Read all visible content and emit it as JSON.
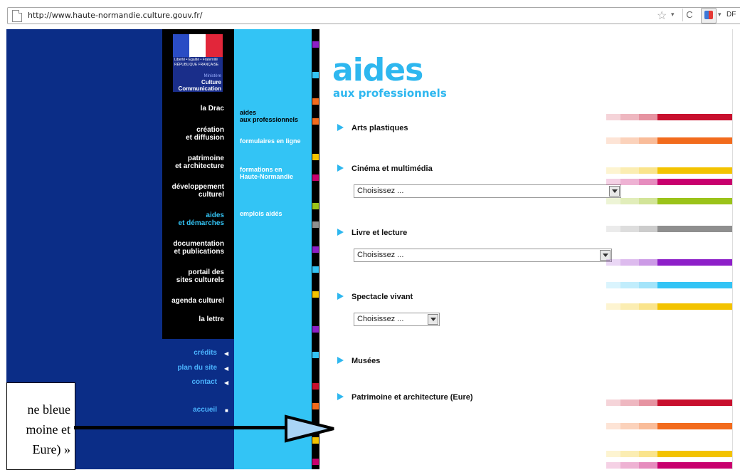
{
  "browser": {
    "url": "http://www.haute-normandie.culture.gouv.fr/",
    "extension_label": "DF"
  },
  "logo": {
    "republic": "Liberté • Égalité • Fraternité\nRÉPUBLIQUE FRANÇAISE",
    "ministry": "Ministère",
    "culture": "Culture\nCommunication"
  },
  "nav": [
    {
      "label": "la Drac",
      "active": false
    },
    {
      "label": "création\net diffusion",
      "active": false
    },
    {
      "label": "patrimoine\net architecture",
      "active": false
    },
    {
      "label": "développement\nculturel",
      "active": false
    },
    {
      "label": "aides\net démarches",
      "active": true
    },
    {
      "label": "documentation\net publications",
      "active": false
    },
    {
      "label": "portail des\nsites culturels",
      "active": false
    },
    {
      "label": "agenda culturel",
      "active": false
    },
    {
      "label": "la lettre",
      "active": false
    }
  ],
  "bottom_links": [
    "crédits",
    "plan du site",
    "contact",
    "accueil"
  ],
  "subnav": [
    {
      "label": "aides\naux professionnels",
      "active": true
    },
    {
      "label": "formulaires en ligne",
      "active": false
    },
    {
      "label": "formations en\nHaute-Normandie",
      "active": false
    },
    {
      "label": "emplois aidés",
      "active": false
    }
  ],
  "main": {
    "title": "aides",
    "subtitle": "aux professionnels",
    "sections": [
      {
        "label": "Arts plastiques"
      },
      {
        "label": "Cinéma et multimédia",
        "select": "Choisissez ..."
      },
      {
        "label": "Livre et lecture",
        "select": "Choisissez ..."
      },
      {
        "label": "Spectacle vivant",
        "select": "Choisissez ..."
      },
      {
        "label": "Musées"
      },
      {
        "label": "Patrimoine et architecture (Eure)"
      }
    ]
  },
  "colors": {
    "accent": "#2eb7ef",
    "navy": "#0b2d87",
    "bars": [
      "#c8102e",
      "#f26b1d",
      "#f3c300",
      "#c8006e",
      "#9bc31a",
      "#8f8f8f",
      "#8d1fc8",
      "#33c4f5",
      "#f3c300",
      "#c8102e",
      "#f26b1d",
      "#f3c300",
      "#c8006e"
    ]
  },
  "callout": {
    "text": "ne bleue\nmoine et\nEure) »"
  }
}
